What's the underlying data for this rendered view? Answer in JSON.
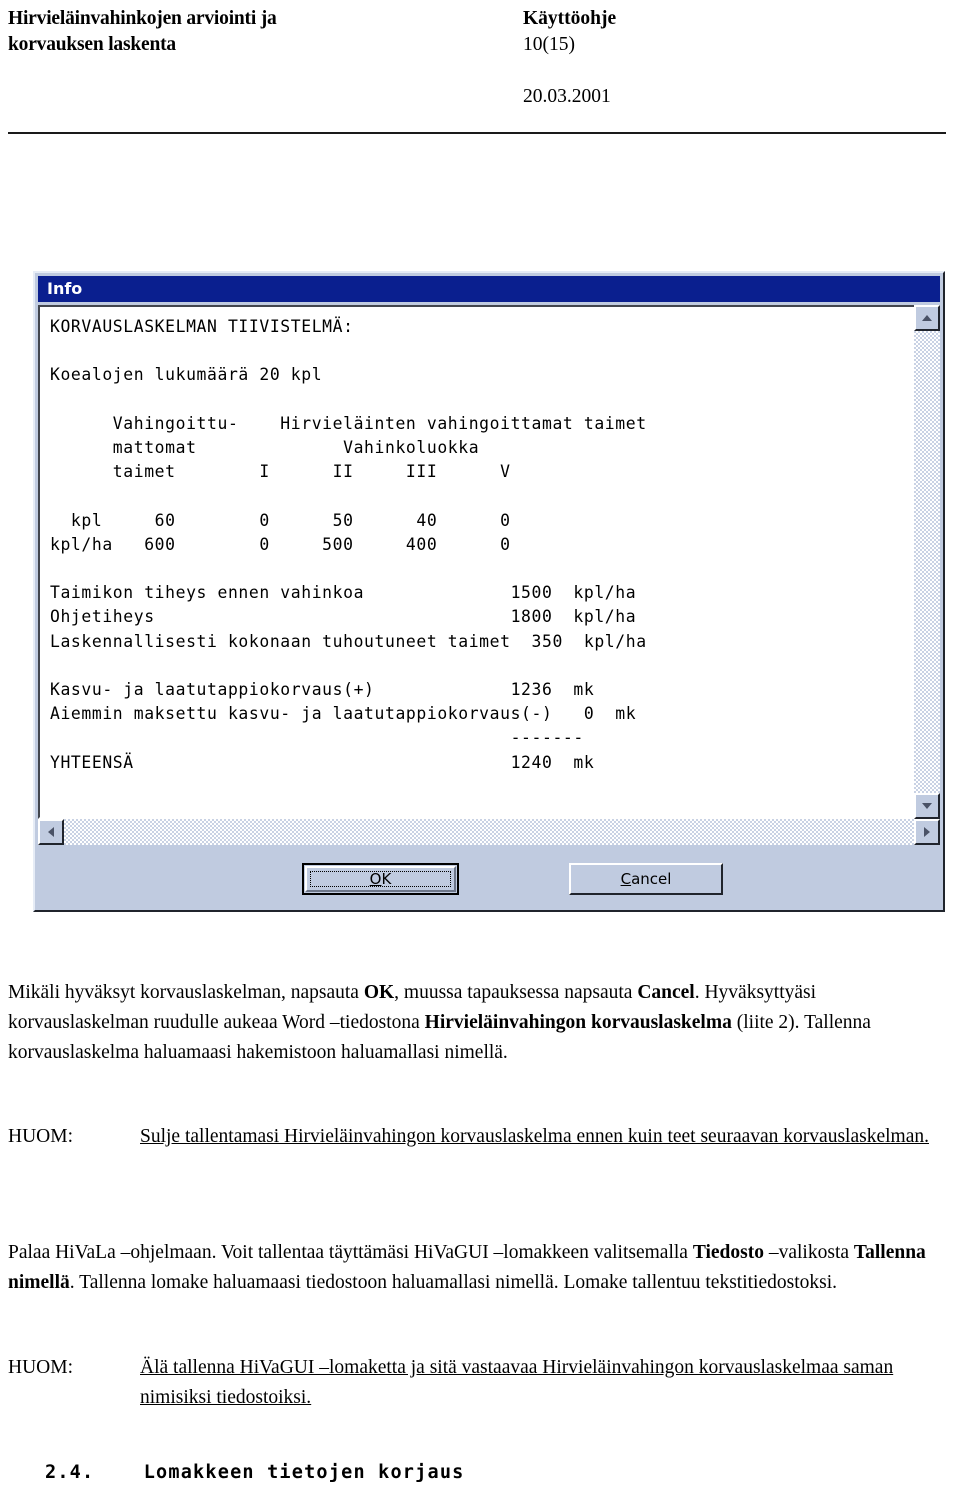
{
  "header": {
    "title_line1": "Hirvieläinvahinkojen arviointi ja",
    "title_line2": "korvauksen laskenta",
    "doc_type": "Käyttöohje",
    "page_number": "10(15)",
    "date": "20.03.2001"
  },
  "dialog": {
    "title": "Info",
    "report_text": "KORVAUSLASKELMAN TIIVISTELMÄ:\n\nKoealojen lukumäärä 20 kpl\n\n      Vahingoittu-    Hirvieläinten vahingoittamat taimet\n      mattomat              Vahinkoluokka\n      taimet        I      II     III      V\n\n  kpl     60        0      50      40      0\nkpl/ha   600        0     500     400      0\n\nTaimikon tiheys ennen vahinkoa              1500  kpl/ha\nOhjetiheys                                  1800  kpl/ha\nLaskennallisesti kokonaan tuhoutuneet taimet  350  kpl/ha\n\nKasvu- ja laatutappiokorvaus(+)             1236  mk\nAiemmin maksettu kasvu- ja laatutappiokorvaus(-)   0  mk\n                                            -------\nYHTEENSÄ                                    1240  mk",
    "summary_heading": "KORVAUSLASKELMAN TIIVISTELMÄ:",
    "plot_count_line": "Koealojen lukumäärä 20 kpl",
    "table": {
      "col0_header_lines": [
        "Vahingoittu-",
        "mattomat",
        "taimet"
      ],
      "group_header": "Hirvieläinten vahingoittamat taimet",
      "group_subheader": "Vahinkoluokka",
      "damage_classes": [
        "I",
        "II",
        "III",
        "V"
      ],
      "rows": [
        {
          "label": "kpl",
          "undamaged": "60",
          "values": [
            "0",
            "50",
            "40",
            "0"
          ]
        },
        {
          "label": "kpl/ha",
          "undamaged": "600",
          "values": [
            "0",
            "500",
            "400",
            "0"
          ]
        }
      ]
    },
    "density_rows": [
      {
        "label": "Taimikon tiheys ennen vahinkoa",
        "value": "1500",
        "unit": "kpl/ha"
      },
      {
        "label": "Ohjetiheys",
        "value": "1800",
        "unit": "kpl/ha"
      },
      {
        "label": "Laskennallisesti kokonaan tuhoutuneet taimet",
        "value": "350",
        "unit": "kpl/ha"
      }
    ],
    "compensation_rows": [
      {
        "label": "Kasvu- ja laatutappiokorvaus(+)",
        "value": "1236",
        "unit": "mk"
      },
      {
        "label": "Aiemmin maksettu kasvu- ja laatutappiokorvaus(-)",
        "value": "0",
        "unit": "mk"
      }
    ],
    "separator": "-------",
    "total_row": {
      "label": "YHTEENSÄ",
      "value": "1240",
      "unit": "mk"
    },
    "buttons": {
      "ok": {
        "mnemonic": "O",
        "rest": "K"
      },
      "cancel": {
        "mnemonic": "C",
        "rest": "ancel"
      }
    },
    "scrollbar": {
      "up_icon": "arrow-up-icon",
      "down_icon": "arrow-down-icon",
      "left_icon": "arrow-left-icon",
      "right_icon": "arrow-right-icon"
    }
  },
  "body": {
    "para1": {
      "s1": "Mikäli hyväksyt korvauslaskelman, napsauta ",
      "b1": "OK",
      "s2": ", muussa tapauksessa napsauta ",
      "b2": "Cancel",
      "s3": ". Hyväksyttyäsi korvauslaskelman ruudulle aukeaa Word –tiedostona ",
      "b3": "Hirvieläinvahingon korvauslaskelma",
      "s4": " (liite 2). Tallenna korvauslaskelma haluamaasi hakemistoon haluamallasi nimellä."
    },
    "huom1": {
      "label": "HUOM:",
      "text": "Sulje tallentamasi Hirvieläinvahingon korvauslaskelma ennen kuin teet seuraavan korvauslaskelman."
    },
    "para2": {
      "s1": "Palaa HiVaLa –ohjelmaan. Voit tallentaa täyttämäsi HiVaGUI –lomakkeen valitsemalla ",
      "b1": "Tiedosto",
      "s2": " –valikosta ",
      "b2": "Tallenna nimellä",
      "s3": ". Tallenna lomake haluamaasi tiedostoon haluamallasi nimellä. Lomake tallentuu tekstitiedostoksi."
    },
    "huom2": {
      "label": "HUOM:",
      "text": "Älä tallenna HiVaGUI –lomaketta ja sitä vastaavaa Hirvieläinvahingon korvauslaskelmaa saman nimisiksi tiedostoiksi."
    },
    "section_heading": "2.4.    Lomakkeen tietojen korjaus"
  },
  "colors": {
    "titlebar": "#0a1f8f",
    "dialog_face": "#c0cbe0",
    "client_bg": "#ffffff",
    "text": "#000000"
  }
}
